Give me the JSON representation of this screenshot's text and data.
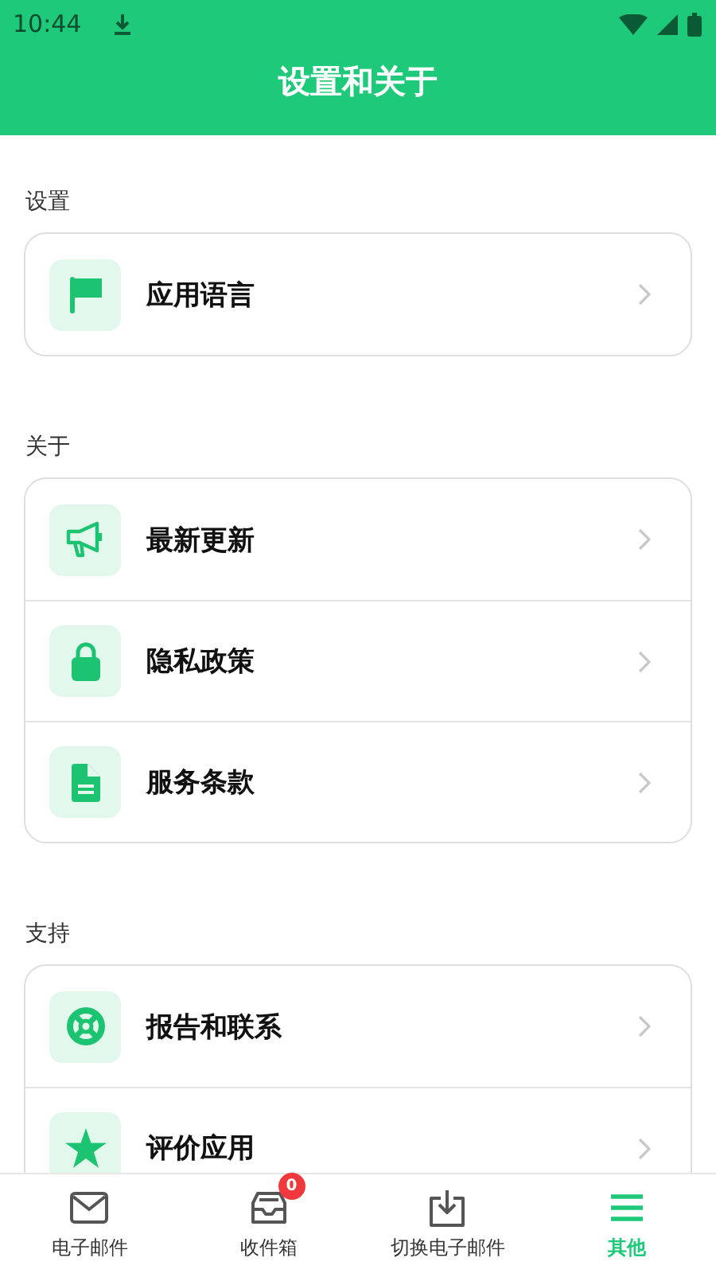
{
  "status_bar": {
    "time": "10:44"
  },
  "header": {
    "title": "设置和关于"
  },
  "sections": [
    {
      "label": "设置",
      "items": [
        {
          "label": "应用语言",
          "kind": "flag"
        }
      ]
    },
    {
      "label": "关于",
      "items": [
        {
          "label": "最新更新",
          "kind": "megaphone"
        },
        {
          "label": "隐私政策",
          "kind": "lock"
        },
        {
          "label": "服务条款",
          "kind": "document"
        }
      ]
    },
    {
      "label": "支持",
      "items": [
        {
          "label": "报告和联系",
          "kind": "lifebuoy"
        },
        {
          "label": "评价应用",
          "kind": "star"
        }
      ]
    }
  ],
  "bottom_nav": [
    {
      "label": "电子邮件",
      "kind": "mail",
      "selected": false
    },
    {
      "label": "收件箱",
      "kind": "inbox",
      "selected": false,
      "badge": "0"
    },
    {
      "label": "切换电子邮件",
      "kind": "download",
      "selected": false
    },
    {
      "label": "其他",
      "kind": "menu",
      "selected": true
    }
  ]
}
